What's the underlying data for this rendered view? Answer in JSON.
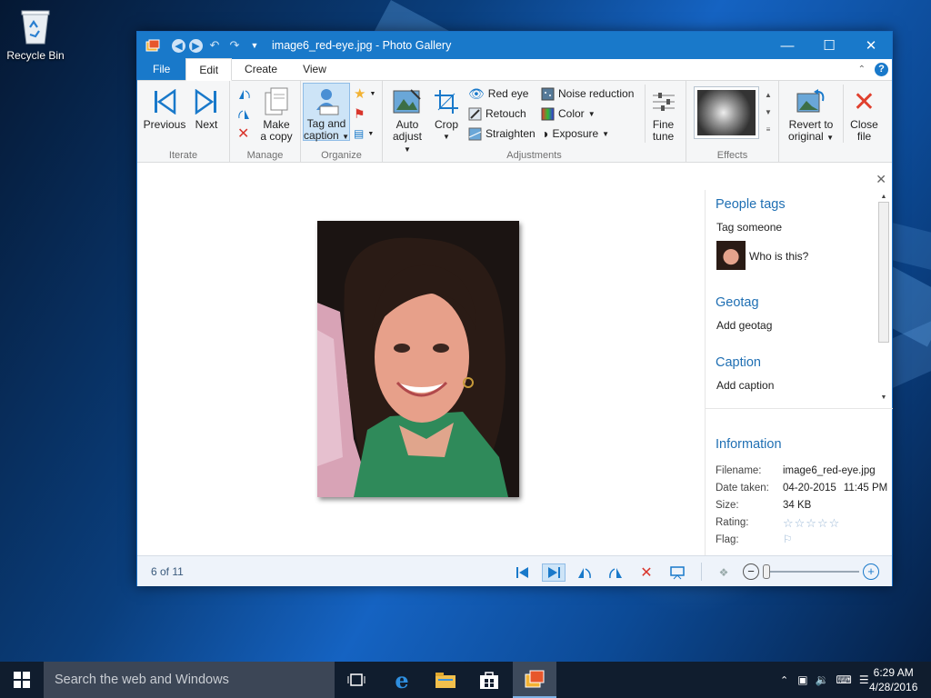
{
  "desktop": {
    "recycle_bin_label": "Recycle Bin"
  },
  "window": {
    "title": "image6_red-eye.jpg - Photo Gallery",
    "tabs": [
      "File",
      "Edit",
      "Create",
      "View"
    ],
    "active_tab": "Edit"
  },
  "ribbon": {
    "iterate": {
      "label": "Iterate",
      "previous": "Previous",
      "next": "Next"
    },
    "manage": {
      "label": "Manage",
      "make_copy_1": "Make",
      "make_copy_2": "a copy"
    },
    "organize": {
      "label": "Organize",
      "tag_caption_1": "Tag and",
      "tag_caption_2": "caption"
    },
    "adjustments": {
      "label": "Adjustments",
      "auto_adjust_1": "Auto",
      "auto_adjust_2": "adjust",
      "crop": "Crop",
      "red_eye": "Red eye",
      "retouch": "Retouch",
      "straighten": "Straighten",
      "noise_reduction": "Noise reduction",
      "color": "Color",
      "exposure": "Exposure",
      "fine_tune_1": "Fine",
      "fine_tune_2": "tune"
    },
    "effects": {
      "label": "Effects"
    },
    "revert_1": "Revert to",
    "revert_2": "original",
    "close_1": "Close",
    "close_2": "file"
  },
  "info_pane": {
    "people_tags": "People tags",
    "tag_someone": "Tag someone",
    "who_is_this": "Who is this?",
    "geotag": "Geotag",
    "add_geotag": "Add geotag",
    "caption": "Caption",
    "add_caption": "Add caption",
    "information": "Information",
    "filename_label": "Filename:",
    "filename_value": "image6_red-eye.jpg",
    "date_label": "Date taken:",
    "date_value": "04-20-2015",
    "time_value": "11:45 PM",
    "size_label": "Size:",
    "size_value": "34 KB",
    "rating_label": "Rating:",
    "rating_value": 0,
    "flag_label": "Flag:"
  },
  "statusbar": {
    "position": "6 of 11",
    "zoom_percent": 0
  },
  "taskbar": {
    "search_placeholder": "Search the web and Windows",
    "time": "6:29 AM",
    "date": "4/28/2016"
  },
  "colors": {
    "accent": "#1979ca",
    "link": "#1f6fb3",
    "taskbar": "#101d2e"
  }
}
